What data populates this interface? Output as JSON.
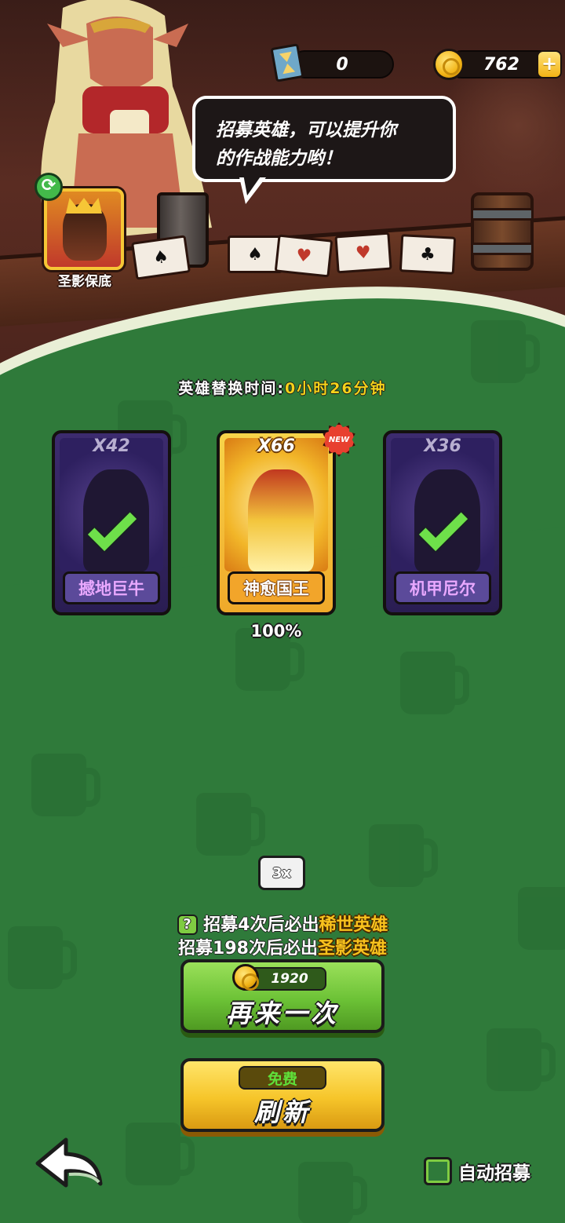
{
  "resources": {
    "hourglass_count": "0",
    "coin_count": "762",
    "add_label": "+"
  },
  "dialog": {
    "line1": "招募英雄，可以提升你",
    "line2": "的作战能力哟！"
  },
  "guarantee_badge": {
    "label": "圣影保底"
  },
  "timer": {
    "label": "英雄替换时间:",
    "value": "0小时26分钟"
  },
  "heroes": [
    {
      "multiplier": "X42",
      "name": "撼地巨牛",
      "rarity": "purple",
      "owned": true
    },
    {
      "multiplier": "X66",
      "name": "神愈国王",
      "rarity": "gold",
      "owned": false,
      "new_badge": "NEW",
      "percent": "100%"
    },
    {
      "multiplier": "X36",
      "name": "机甲尼尔",
      "rarity": "purple",
      "owned": true
    }
  ],
  "speed": {
    "label": "3x"
  },
  "guarantees": {
    "help": "?",
    "line1_prefix": "招募4次后必出",
    "line1_highlight": "稀世英雄",
    "line2_prefix": "招募198次后必出",
    "line2_highlight": "圣影英雄"
  },
  "recruit_again": {
    "cost": "1920",
    "label": "再来一次"
  },
  "refresh": {
    "cost_label": "免费",
    "label": "刷新"
  },
  "auto_recruit": {
    "label": "自动招募",
    "checked": false
  },
  "colors": {
    "field_green": "#2f7a3a",
    "highlight_gold": "#f8c21d",
    "purple_rarity": "#5b4a9a",
    "gold_rarity": "#f2a52a"
  }
}
